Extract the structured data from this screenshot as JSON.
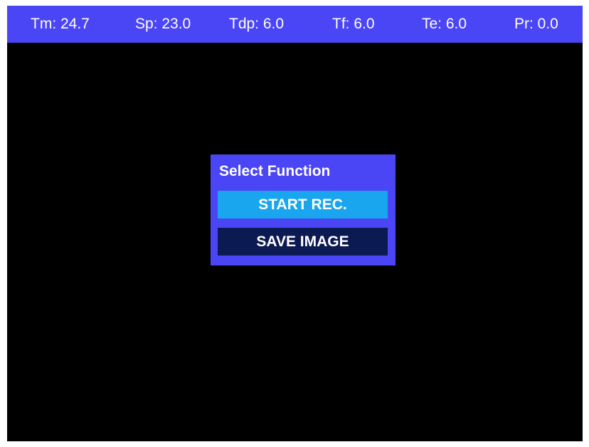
{
  "status_bar": {
    "tm": "Tm: 24.7",
    "sp": "Sp: 23.0",
    "tdp": "Tdp: 6.0",
    "tf": "Tf: 6.0",
    "te": "Te: 6.0",
    "pr": "Pr: 0.0"
  },
  "dialog": {
    "title": "Select Function",
    "start_rec_label": "START REC.",
    "save_image_label": "SAVE IMAGE",
    "selected": "START REC."
  },
  "colors": {
    "bar_bg": "#4a45f5",
    "selected_bg": "#1aa6ee",
    "unselected_bg": "#0b1a52",
    "screen_bg": "#000000"
  }
}
